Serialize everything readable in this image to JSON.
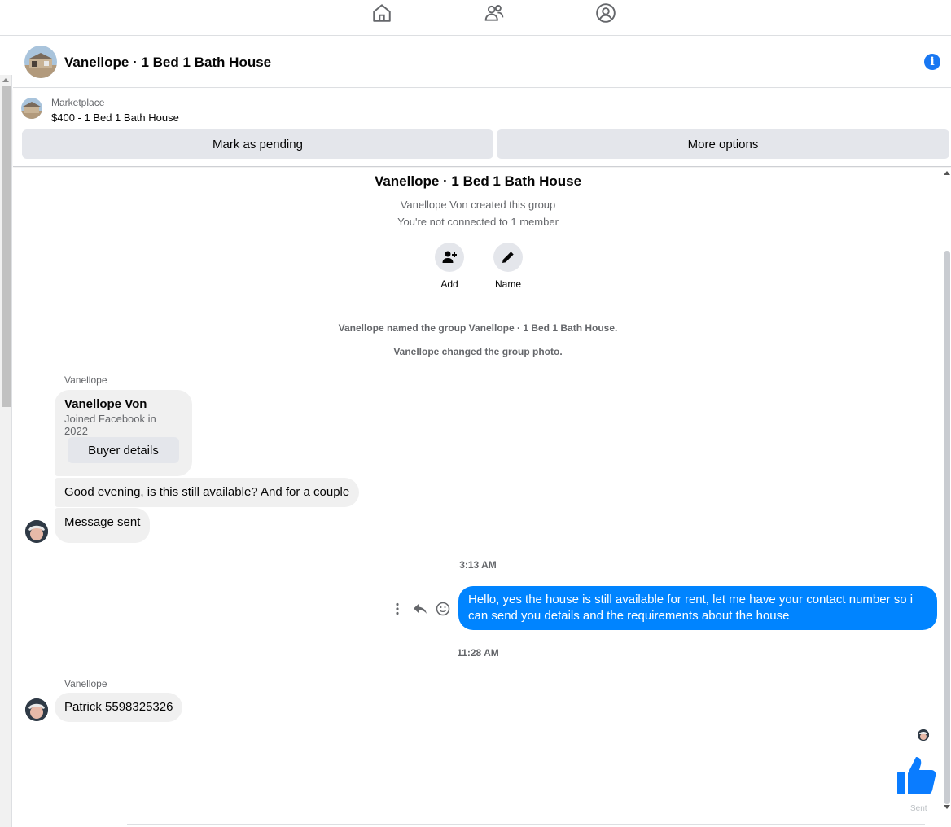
{
  "nav": {
    "icons": [
      "home-icon",
      "friends-icon",
      "profile-icon"
    ]
  },
  "header": {
    "title": "Vanellope · 1 Bed 1 Bath House",
    "info_icon": "info-icon",
    "info_symbol": "i"
  },
  "marketplace": {
    "label": "Marketplace",
    "listing": "$400 - 1 Bed 1 Bath House",
    "pending_label": "Mark as pending",
    "more_label": "More options"
  },
  "conversation": {
    "group_title": "Vanellope · 1 Bed 1 Bath House",
    "created_by": "Vanellope Von created this group",
    "not_connected": "You're not connected to 1 member",
    "actions": [
      {
        "label": "Add",
        "icon": "add-person-icon"
      },
      {
        "label": "Name",
        "icon": "pencil-icon"
      }
    ],
    "system_messages": [
      "Vanellope named the group Vanellope · 1 Bed 1 Bath House.",
      "Vanellope changed the group photo."
    ],
    "buyer_card": {
      "sender": "Vanellope",
      "name": "Vanellope Von",
      "joined": "Joined Facebook in 2022",
      "button": "Buyer details"
    },
    "incoming_1": "Good evening, is this still available? And for a couple",
    "incoming_2": "Message sent",
    "time_1": "3:13 AM",
    "outgoing": "Hello, yes the house is still available for rent, let me have your contact number so i can send you details and the requirements about the house",
    "time_2": "11:28 AM",
    "sender_2": "Vanellope",
    "incoming_3": "Patrick 5598325326",
    "like_label": "Sent"
  },
  "colors": {
    "accent": "#1877f2",
    "outgoing_bubble": "#0084ff",
    "incoming_bubble": "#f0f0f0"
  }
}
